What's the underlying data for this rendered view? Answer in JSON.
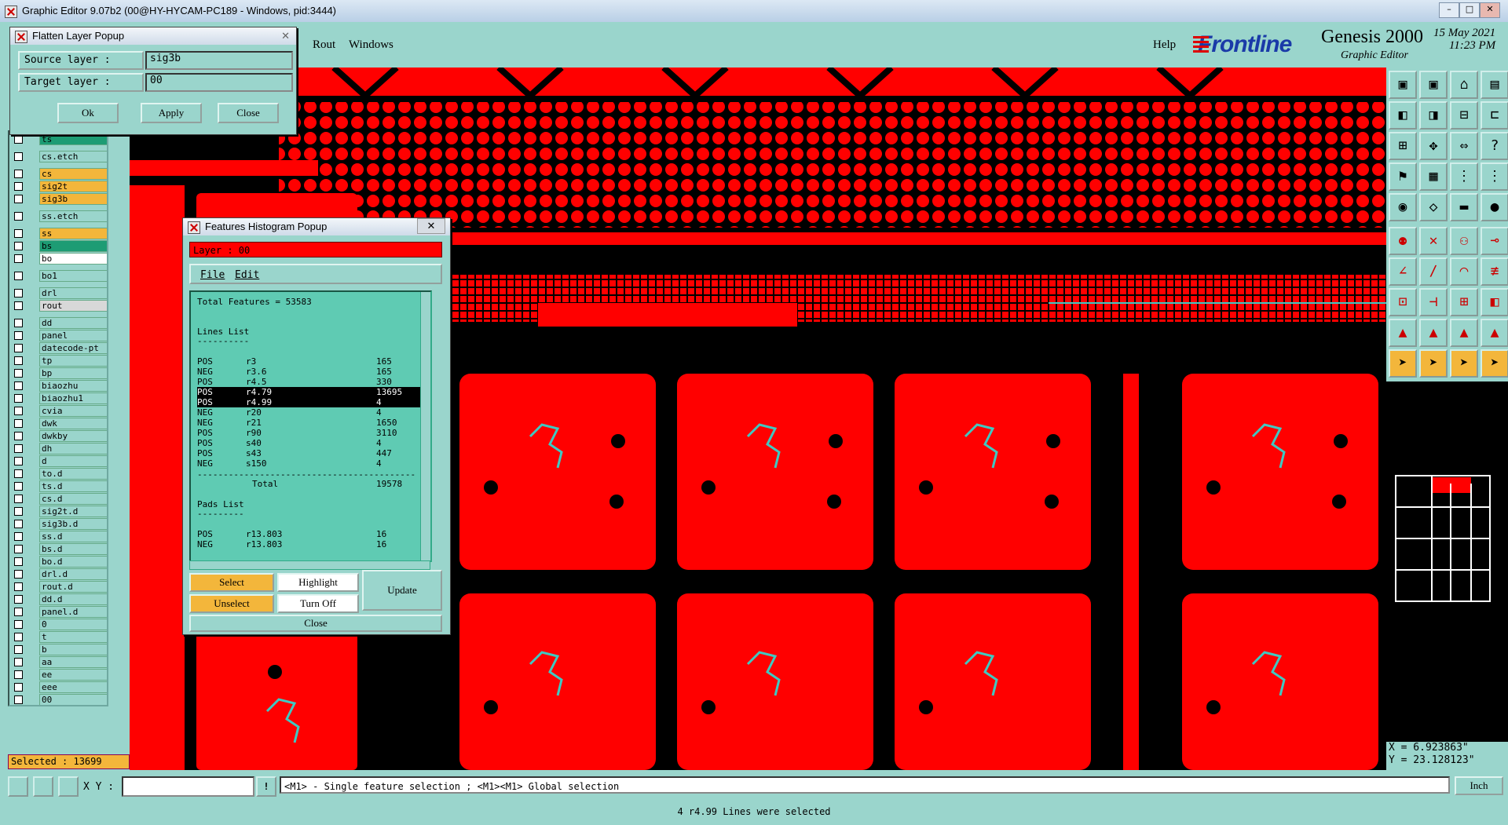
{
  "window": {
    "title": "Graphic Editor 9.07b2 (00@HY-HYCAM-PC189 - Windows, pid:3444)"
  },
  "menu": {
    "items": [
      "Rout",
      "Windows"
    ],
    "help": "Help"
  },
  "brand": {
    "logo": "Frontline",
    "product": "Genesis 2000",
    "subtitle": "Graphic Editor",
    "date": "15 May 2021",
    "time": "11:23 PM"
  },
  "flatten_popup": {
    "title": "Flatten Layer Popup",
    "source_label": "Source layer :",
    "source_value": "sig3b",
    "target_label": "Target layer :",
    "target_value": "00",
    "ok": "Ok",
    "apply": "Apply",
    "close": "Close"
  },
  "layers": [
    {
      "name": "ts",
      "color": "#1d9c74"
    },
    {
      "name": "cs.etch",
      "color": "#9ad5cc"
    },
    {
      "name": "cs",
      "color": "#f3b63b"
    },
    {
      "name": "sig2t",
      "color": "#f3b63b"
    },
    {
      "name": "sig3b",
      "color": "#f3b63b"
    },
    {
      "name": "ss.etch",
      "color": "#9ad5cc"
    },
    {
      "name": "ss",
      "color": "#f3b63b"
    },
    {
      "name": "bs",
      "color": "#1d9c74"
    },
    {
      "name": "bo",
      "color": "#ffffff"
    },
    {
      "name": "bo1",
      "color": "#9ad5cc"
    },
    {
      "name": "drl",
      "color": "#9ad5cc"
    },
    {
      "name": "rout",
      "color": "#d8d8d8"
    },
    {
      "name": "dd",
      "color": "#9ad5cc"
    },
    {
      "name": "panel",
      "color": "#9ad5cc"
    },
    {
      "name": "datecode-pt",
      "color": "#9ad5cc"
    },
    {
      "name": "tp",
      "color": "#9ad5cc"
    },
    {
      "name": "bp",
      "color": "#9ad5cc"
    },
    {
      "name": "biaozhu",
      "color": "#9ad5cc"
    },
    {
      "name": "biaozhu1",
      "color": "#9ad5cc"
    },
    {
      "name": "cvia",
      "color": "#9ad5cc"
    },
    {
      "name": "dwk",
      "color": "#9ad5cc"
    },
    {
      "name": "dwkby",
      "color": "#9ad5cc"
    },
    {
      "name": "dh",
      "color": "#9ad5cc"
    },
    {
      "name": "d",
      "color": "#9ad5cc"
    },
    {
      "name": "to.d",
      "color": "#9ad5cc"
    },
    {
      "name": "ts.d",
      "color": "#9ad5cc"
    },
    {
      "name": "cs.d",
      "color": "#9ad5cc"
    },
    {
      "name": "sig2t.d",
      "color": "#9ad5cc"
    },
    {
      "name": "sig3b.d",
      "color": "#9ad5cc"
    },
    {
      "name": "ss.d",
      "color": "#9ad5cc"
    },
    {
      "name": "bs.d",
      "color": "#9ad5cc"
    },
    {
      "name": "bo.d",
      "color": "#9ad5cc"
    },
    {
      "name": "drl.d",
      "color": "#9ad5cc"
    },
    {
      "name": "rout.d",
      "color": "#9ad5cc"
    },
    {
      "name": "dd.d",
      "color": "#9ad5cc"
    },
    {
      "name": "panel.d",
      "color": "#9ad5cc"
    },
    {
      "name": "0",
      "color": "#9ad5cc"
    },
    {
      "name": "t",
      "color": "#9ad5cc"
    },
    {
      "name": "b",
      "color": "#9ad5cc"
    },
    {
      "name": "aa",
      "color": "#9ad5cc"
    },
    {
      "name": "ee",
      "color": "#9ad5cc"
    },
    {
      "name": "eee",
      "color": "#9ad5cc"
    },
    {
      "name": "00",
      "color": "#9ad5cc"
    }
  ],
  "selected_count": "Selected : 13699",
  "histogram_popup": {
    "title": "Features Histogram Popup",
    "layer_label": "Layer :  00",
    "menu_file": "File",
    "menu_edit": "Edit",
    "total_features": "Total Features = 53583",
    "lines_header": "Lines List",
    "lines": [
      {
        "pol": "POS",
        "sym": "r3",
        "count": "165"
      },
      {
        "pol": "NEG",
        "sym": "r3.6",
        "count": "165"
      },
      {
        "pol": "POS",
        "sym": "r4.5",
        "count": "330"
      },
      {
        "pol": "POS",
        "sym": "r4.79",
        "count": "13695"
      },
      {
        "pol": "POS",
        "sym": "r4.99",
        "count": "4"
      },
      {
        "pol": "NEG",
        "sym": "r20",
        "count": "4"
      },
      {
        "pol": "NEG",
        "sym": "r21",
        "count": "1650"
      },
      {
        "pol": "POS",
        "sym": "r90",
        "count": "3110"
      },
      {
        "pol": "POS",
        "sym": "s40",
        "count": "4"
      },
      {
        "pol": "POS",
        "sym": "s43",
        "count": "447"
      },
      {
        "pol": "NEG",
        "sym": "s150",
        "count": "4"
      }
    ],
    "total_label": "Total",
    "total_value": "19578",
    "pads_header": "Pads List",
    "pads": [
      {
        "pol": "POS",
        "sym": "r13.803",
        "count": "16"
      },
      {
        "pol": "NEG",
        "sym": "r13.803",
        "count": "16"
      }
    ],
    "select": "Select",
    "highlight": "Highlight",
    "update": "Update",
    "unselect": "Unselect",
    "turn_off": "Turn Off",
    "close": "Close"
  },
  "coords": {
    "x": "X = 6.923863\"",
    "y": "Y = 23.128123\""
  },
  "bottom": {
    "xy_label": "X Y :",
    "xy_value": "",
    "hint": "<M1> - Single feature selection ; <M1><M1> Global selection",
    "units": "Inch",
    "status": "4 r4.99 Lines were selected"
  }
}
